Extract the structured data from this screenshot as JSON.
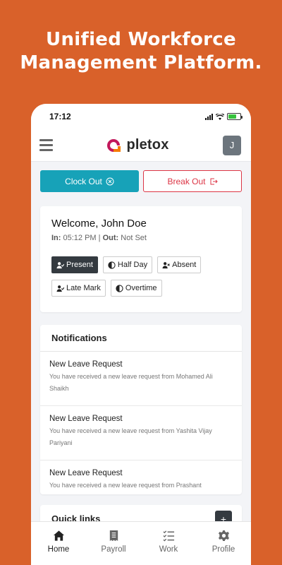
{
  "promo": {
    "line1": "Unified Workforce",
    "line2": "Management Platform."
  },
  "status_bar": {
    "time": "17:12"
  },
  "app": {
    "brand": "pletox",
    "avatar_initial": "J"
  },
  "actions": {
    "clock_out": "Clock Out",
    "break_out": "Break Out"
  },
  "welcome": {
    "greeting": "Welcome, John Doe",
    "in_label": "In:",
    "in_time": "05:12 PM",
    "separator": "|",
    "out_label": "Out:",
    "out_value": "Not Set"
  },
  "attendance": {
    "options": [
      "Present",
      "Half Day",
      "Absent",
      "Late Mark",
      "Overtime"
    ],
    "selected": "Present"
  },
  "notifications": {
    "title": "Notifications",
    "items": [
      {
        "title": "New Leave Request",
        "message": "You have received a new leave request from Mohamed Ali Shaikh"
      },
      {
        "title": "New Leave Request",
        "message": "You have received a new leave request from Yashita Vijay Pariyani"
      },
      {
        "title": "New Leave Request",
        "message": "You have received a new leave request from Prashant"
      }
    ]
  },
  "quick_links": {
    "title": "Quick links",
    "add_button": "+"
  },
  "bottom_nav": {
    "items": [
      "Home",
      "Payroll",
      "Work",
      "Profile"
    ],
    "active": "Home"
  },
  "colors": {
    "background": "#D9612A",
    "clock_out": "#17A2B8",
    "break_out": "#DC3545",
    "chip_active": "#343A40",
    "brand_accent": "#C2185B"
  }
}
